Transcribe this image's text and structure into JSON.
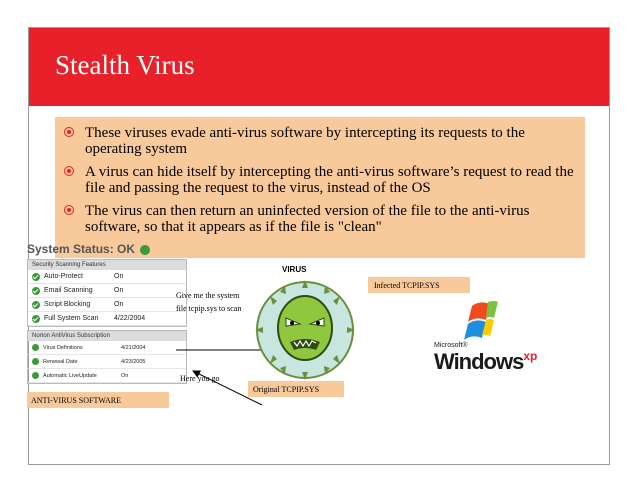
{
  "slide": {
    "title": "Stealth Virus",
    "bullets": [
      "These viruses evade anti-virus software by intercepting its requests to the operating system",
      "A virus can hide itself by intercepting the anti-virus software’s request to read the file and passing the request to the virus, instead of the OS",
      "The virus can then return an uninfected version of the file to the anti-virus software, so that it appears as if the file is \"clean\""
    ]
  },
  "status_panel": {
    "title": "System Status: OK",
    "section1_header": "Security Scanning Features",
    "features": [
      {
        "label": "Auto-Protect",
        "value": "On"
      },
      {
        "label": "Email Scanning",
        "value": "On"
      },
      {
        "label": "Script Blocking",
        "value": "On"
      },
      {
        "label": "Full System Scan",
        "value": "4/22/2004"
      }
    ],
    "section2_header": "Norton AntiVirus Subscription",
    "subscription": [
      {
        "label": "Virus Definitions",
        "value": "4/21/2004"
      },
      {
        "label": "Renewal Date",
        "value": "4/23/2005"
      },
      {
        "label": "Automatic LiveUpdate",
        "value": "On"
      }
    ]
  },
  "diagram": {
    "antivirus_label": "ANTI-VIRUS SOFTWARE",
    "request_text_line1": "Give me the system",
    "request_text_line2": "file tcpip.sys to scan",
    "reply_text": "Here you go",
    "virus_label": "VIRUS",
    "original_label": "Original TCPIP.SYS",
    "infected_label": "Infected TCPIP.SYS"
  },
  "logo": {
    "microsoft": "Microsoft®",
    "windows": "Windows",
    "xp": "xp"
  }
}
